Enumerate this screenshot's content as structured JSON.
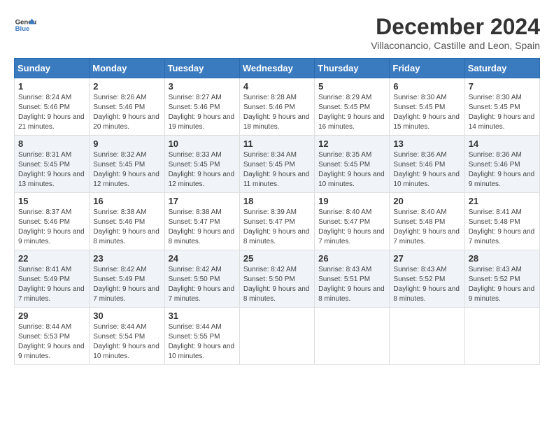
{
  "logo": {
    "line1": "General",
    "line2": "Blue"
  },
  "title": "December 2024",
  "location": "Villaconancio, Castille and Leon, Spain",
  "days_of_week": [
    "Sunday",
    "Monday",
    "Tuesday",
    "Wednesday",
    "Thursday",
    "Friday",
    "Saturday"
  ],
  "weeks": [
    [
      {
        "day": "1",
        "sunrise": "8:24 AM",
        "sunset": "5:46 PM",
        "daylight": "9 hours and 21 minutes."
      },
      {
        "day": "2",
        "sunrise": "8:26 AM",
        "sunset": "5:46 PM",
        "daylight": "9 hours and 20 minutes."
      },
      {
        "day": "3",
        "sunrise": "8:27 AM",
        "sunset": "5:46 PM",
        "daylight": "9 hours and 19 minutes."
      },
      {
        "day": "4",
        "sunrise": "8:28 AM",
        "sunset": "5:46 PM",
        "daylight": "9 hours and 18 minutes."
      },
      {
        "day": "5",
        "sunrise": "8:29 AM",
        "sunset": "5:45 PM",
        "daylight": "9 hours and 16 minutes."
      },
      {
        "day": "6",
        "sunrise": "8:30 AM",
        "sunset": "5:45 PM",
        "daylight": "9 hours and 15 minutes."
      },
      {
        "day": "7",
        "sunrise": "8:30 AM",
        "sunset": "5:45 PM",
        "daylight": "9 hours and 14 minutes."
      }
    ],
    [
      {
        "day": "8",
        "sunrise": "8:31 AM",
        "sunset": "5:45 PM",
        "daylight": "9 hours and 13 minutes."
      },
      {
        "day": "9",
        "sunrise": "8:32 AM",
        "sunset": "5:45 PM",
        "daylight": "9 hours and 12 minutes."
      },
      {
        "day": "10",
        "sunrise": "8:33 AM",
        "sunset": "5:45 PM",
        "daylight": "9 hours and 12 minutes."
      },
      {
        "day": "11",
        "sunrise": "8:34 AM",
        "sunset": "5:45 PM",
        "daylight": "9 hours and 11 minutes."
      },
      {
        "day": "12",
        "sunrise": "8:35 AM",
        "sunset": "5:45 PM",
        "daylight": "9 hours and 10 minutes."
      },
      {
        "day": "13",
        "sunrise": "8:36 AM",
        "sunset": "5:46 PM",
        "daylight": "9 hours and 10 minutes."
      },
      {
        "day": "14",
        "sunrise": "8:36 AM",
        "sunset": "5:46 PM",
        "daylight": "9 hours and 9 minutes."
      }
    ],
    [
      {
        "day": "15",
        "sunrise": "8:37 AM",
        "sunset": "5:46 PM",
        "daylight": "9 hours and 9 minutes."
      },
      {
        "day": "16",
        "sunrise": "8:38 AM",
        "sunset": "5:46 PM",
        "daylight": "9 hours and 8 minutes."
      },
      {
        "day": "17",
        "sunrise": "8:38 AM",
        "sunset": "5:47 PM",
        "daylight": "9 hours and 8 minutes."
      },
      {
        "day": "18",
        "sunrise": "8:39 AM",
        "sunset": "5:47 PM",
        "daylight": "9 hours and 8 minutes."
      },
      {
        "day": "19",
        "sunrise": "8:40 AM",
        "sunset": "5:47 PM",
        "daylight": "9 hours and 7 minutes."
      },
      {
        "day": "20",
        "sunrise": "8:40 AM",
        "sunset": "5:48 PM",
        "daylight": "9 hours and 7 minutes."
      },
      {
        "day": "21",
        "sunrise": "8:41 AM",
        "sunset": "5:48 PM",
        "daylight": "9 hours and 7 minutes."
      }
    ],
    [
      {
        "day": "22",
        "sunrise": "8:41 AM",
        "sunset": "5:49 PM",
        "daylight": "9 hours and 7 minutes."
      },
      {
        "day": "23",
        "sunrise": "8:42 AM",
        "sunset": "5:49 PM",
        "daylight": "9 hours and 7 minutes."
      },
      {
        "day": "24",
        "sunrise": "8:42 AM",
        "sunset": "5:50 PM",
        "daylight": "9 hours and 7 minutes."
      },
      {
        "day": "25",
        "sunrise": "8:42 AM",
        "sunset": "5:50 PM",
        "daylight": "9 hours and 8 minutes."
      },
      {
        "day": "26",
        "sunrise": "8:43 AM",
        "sunset": "5:51 PM",
        "daylight": "9 hours and 8 minutes."
      },
      {
        "day": "27",
        "sunrise": "8:43 AM",
        "sunset": "5:52 PM",
        "daylight": "9 hours and 8 minutes."
      },
      {
        "day": "28",
        "sunrise": "8:43 AM",
        "sunset": "5:52 PM",
        "daylight": "9 hours and 9 minutes."
      }
    ],
    [
      {
        "day": "29",
        "sunrise": "8:44 AM",
        "sunset": "5:53 PM",
        "daylight": "9 hours and 9 minutes."
      },
      {
        "day": "30",
        "sunrise": "8:44 AM",
        "sunset": "5:54 PM",
        "daylight": "9 hours and 10 minutes."
      },
      {
        "day": "31",
        "sunrise": "8:44 AM",
        "sunset": "5:55 PM",
        "daylight": "9 hours and 10 minutes."
      },
      null,
      null,
      null,
      null
    ]
  ]
}
